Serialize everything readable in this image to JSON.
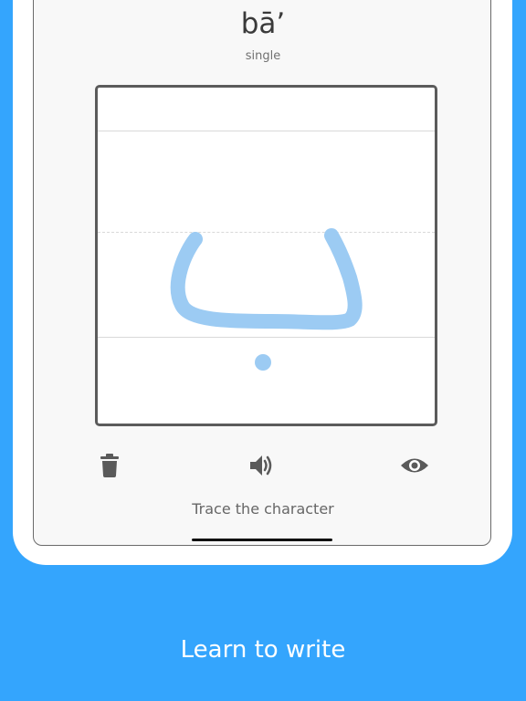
{
  "header": {
    "romanization": "bāʼ",
    "meaning": "single"
  },
  "canvas": {
    "stroke_color": "#9ccbf3"
  },
  "toolbar": {
    "clear_icon": "trash-icon",
    "sound_icon": "speaker-icon",
    "reveal_icon": "eye-icon"
  },
  "instruction": "Trace the character",
  "caption": "Learn to write",
  "colors": {
    "background": "#34a5fd",
    "icon": "#5a5a5a"
  }
}
